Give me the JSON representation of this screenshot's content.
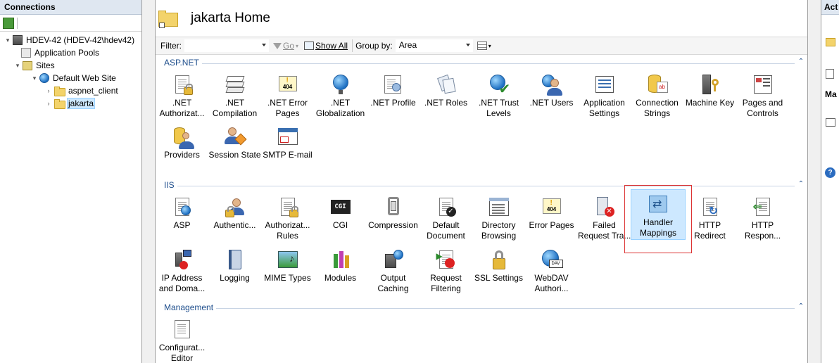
{
  "connections": {
    "title": "Connections",
    "tree": [
      {
        "label": "HDEV-42 (HDEV-42\\hdev42)",
        "level": "server",
        "expanded": true
      },
      {
        "label": "Application Pools",
        "level": "child"
      },
      {
        "label": "Sites",
        "level": "child",
        "expanded": true
      },
      {
        "label": "Default Web Site",
        "level": "grandchild",
        "expanded": true
      },
      {
        "label": "aspnet_client",
        "level": "leaf"
      },
      {
        "label": "jakarta",
        "level": "leaf",
        "selected": true
      }
    ]
  },
  "main": {
    "title": "jakarta Home",
    "filter": {
      "filter_label": "Filter:",
      "filter_value": "",
      "go_label": "Go",
      "show_all_label": "Show All",
      "group_by_label": "Group by:",
      "group_by_value": "Area"
    },
    "groups": [
      {
        "name": "ASP.NET",
        "items": [
          {
            "label1": ".NET",
            "label2": "Authorizat..."
          },
          {
            "label1": ".NET",
            "label2": "Compilation"
          },
          {
            "label1": ".NET Error",
            "label2": "Pages"
          },
          {
            "label1": ".NET",
            "label2": "Globalization"
          },
          {
            "label1": ".NET Profile",
            "label2": ""
          },
          {
            "label1": ".NET Roles",
            "label2": ""
          },
          {
            "label1": ".NET Trust",
            "label2": "Levels"
          },
          {
            "label1": ".NET Users",
            "label2": ""
          },
          {
            "label1": "Application",
            "label2": "Settings"
          },
          {
            "label1": "Connection",
            "label2": "Strings"
          },
          {
            "label1": "Machine Key",
            "label2": ""
          },
          {
            "label1": "Pages and",
            "label2": "Controls"
          },
          {
            "label1": "Providers",
            "label2": ""
          },
          {
            "label1": "Session State",
            "label2": ""
          },
          {
            "label1": "SMTP E-mail",
            "label2": ""
          }
        ]
      },
      {
        "name": "IIS",
        "items": [
          {
            "label1": "ASP",
            "label2": ""
          },
          {
            "label1": "Authentic...",
            "label2": ""
          },
          {
            "label1": "Authorizat...",
            "label2": "Rules"
          },
          {
            "label1": "CGI",
            "label2": ""
          },
          {
            "label1": "Compression",
            "label2": ""
          },
          {
            "label1": "Default",
            "label2": "Document"
          },
          {
            "label1": "Directory",
            "label2": "Browsing"
          },
          {
            "label1": "Error Pages",
            "label2": ""
          },
          {
            "label1": "Failed",
            "label2": "Request Tra..."
          },
          {
            "label1": "Handler",
            "label2": "Mappings",
            "highlighted": true
          },
          {
            "label1": "HTTP",
            "label2": "Redirect"
          },
          {
            "label1": "HTTP",
            "label2": "Respon..."
          },
          {
            "label1": "IP Address",
            "label2": "and Doma..."
          },
          {
            "label1": "Logging",
            "label2": ""
          },
          {
            "label1": "MIME Types",
            "label2": ""
          },
          {
            "label1": "Modules",
            "label2": ""
          },
          {
            "label1": "Output",
            "label2": "Caching"
          },
          {
            "label1": "Request",
            "label2": "Filtering"
          },
          {
            "label1": "SSL Settings",
            "label2": ""
          },
          {
            "label1": "WebDAV",
            "label2": "Authori..."
          }
        ]
      },
      {
        "name": "Management",
        "items": [
          {
            "label1": "Configurat...",
            "label2": "Editor"
          }
        ]
      }
    ]
  },
  "actions": {
    "title": "Act",
    "manage_title": "Ma"
  }
}
